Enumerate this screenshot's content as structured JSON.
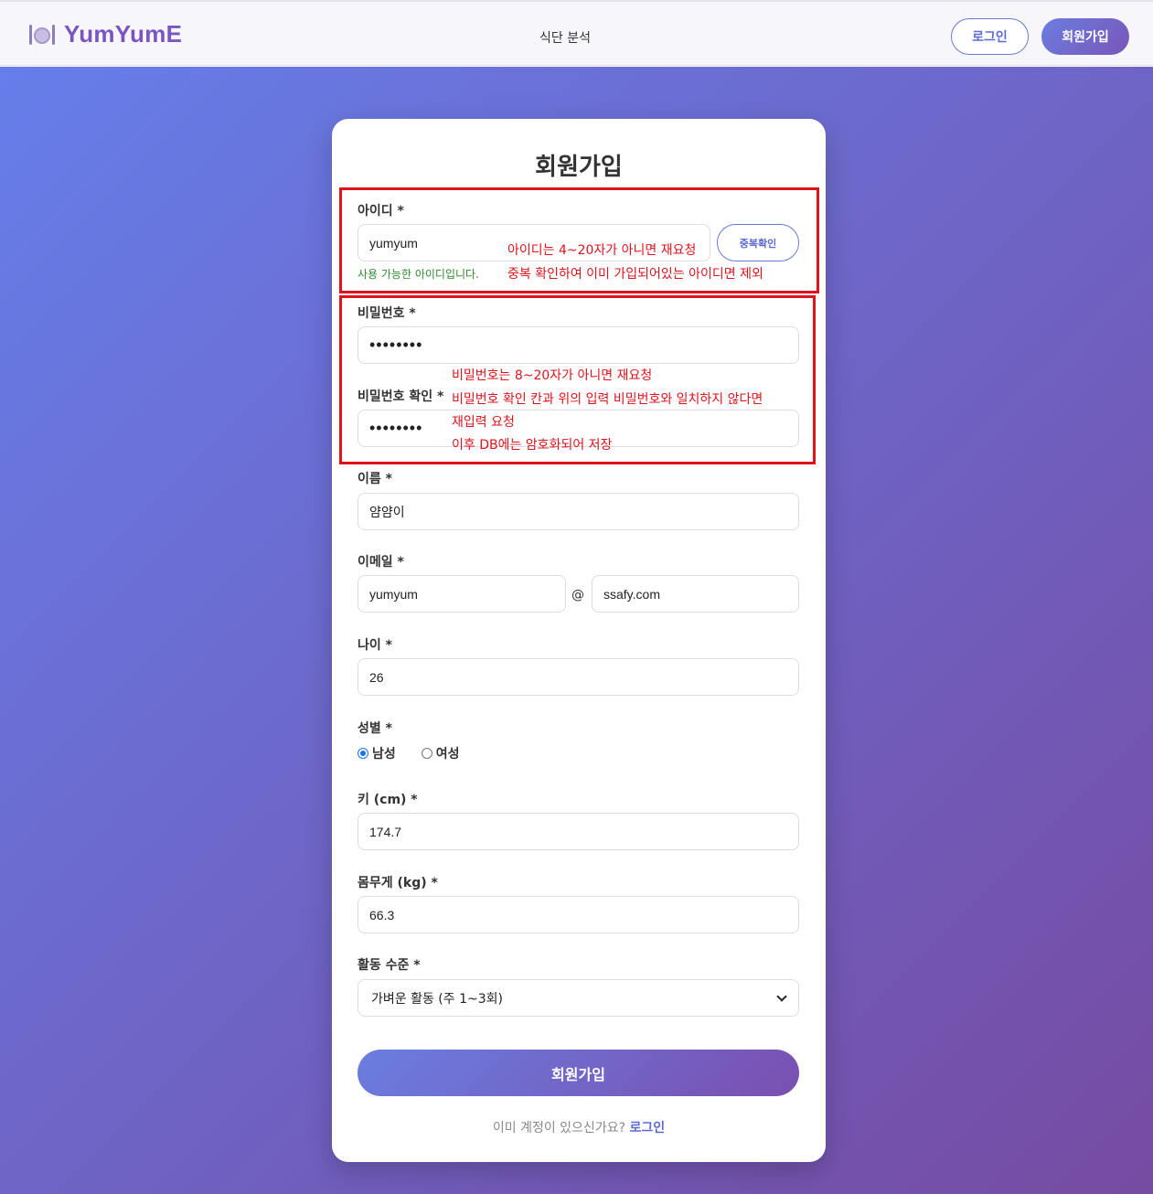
{
  "header": {
    "brand": "YumYumE",
    "nav_link": "식단 분석",
    "login_label": "로그인",
    "signup_label": "회원가입"
  },
  "form": {
    "title": "회원가입",
    "username": {
      "label": "아이디 *",
      "value": "yumyum",
      "check_button": "중복확인",
      "status": "사용 가능한 아이디입니다."
    },
    "password": {
      "label": "비밀번호 *",
      "value": "••••••••"
    },
    "password_confirm": {
      "label": "비밀번호 확인 *",
      "value": "••••••••"
    },
    "name": {
      "label": "이름 *",
      "value": "얌얌이"
    },
    "email": {
      "label": "이메일 *",
      "local": "yumyum",
      "at": "@",
      "domain": "ssafy.com"
    },
    "age": {
      "label": "나이 *",
      "value": "26"
    },
    "gender": {
      "label": "성별 *",
      "options": [
        "남성",
        "여성"
      ],
      "selected": "남성"
    },
    "height": {
      "label": "키 (cm) *",
      "value": "174.7"
    },
    "weight": {
      "label": "몸무게 (kg) *",
      "value": "66.3"
    },
    "activity": {
      "label": "활동 수준 *",
      "value": "가벼운 활동 (주 1~3회)"
    },
    "submit_label": "회원가입",
    "footer_text": "이미 계정이 있으신가요?",
    "footer_link": "로그인"
  },
  "annotations": {
    "id_line1": "아이디는 4~20자가 아니면 재요청",
    "id_line2": "중복 확인하여 이미 가입되어있는 아이디면 제외",
    "pw_line1": "비밀번호는 8~20자가 아니면 재요청",
    "pw_line2": "비밀번호 확인 칸과 위의 입력 비밀번호와 일치하지 않다면",
    "pw_line3": "재입력 요청",
    "pw_line4": "이후 DB에는 암호화되어 저장",
    "color": "#e0121b"
  }
}
